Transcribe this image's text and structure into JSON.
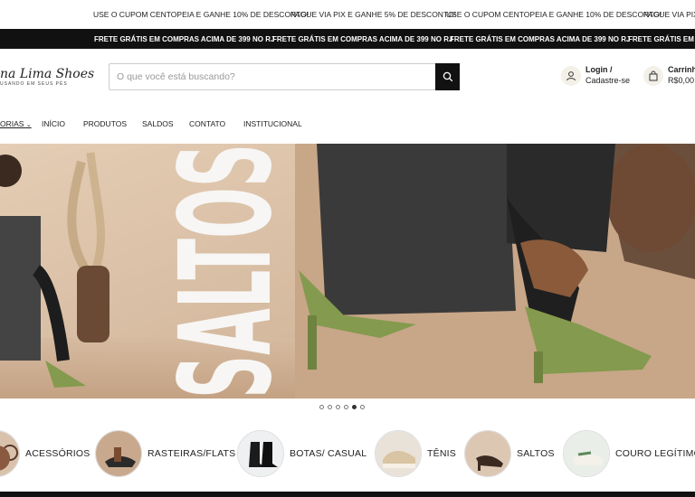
{
  "ticker_top": {
    "messages": [
      "USE O CUPOM CENTOPEIA E GANHE 10% DE DESCONTO!",
      "PAGUE VIA PIX E GANHE 5% DE DESCONTO!",
      "USE O CUPOM CENTOPEIA E GANHE 10% DE DESCONTO!",
      "PAGUE VIA PIX E"
    ]
  },
  "ticker_bottom": {
    "messages": [
      "FRETE GRÁTIS EM COMPRAS ACIMA DE 399 NO RJ",
      "FRETE GRÁTIS EM COMPRAS ACIMA DE 399 NO RJ",
      "FRETE GRÁTIS EM COMPRAS ACIMA DE 399 NO RJ",
      "FRETE GRÁTIS EM C"
    ]
  },
  "header": {
    "logo_text": "na Lima Shoes",
    "logo_tagline": "USANDO EM SEUS PÉS",
    "search_placeholder": "O que você está buscando?",
    "account_line1": "Login /",
    "account_line2": "Cadastre-se",
    "cart_line1": "Carrinho",
    "cart_line2": "R$0,00"
  },
  "nav": {
    "items": [
      "ORIAS",
      "INÍCIO",
      "PRODUTOS",
      "SALDOS",
      "CONTATO",
      "INSTITUCIONAL"
    ]
  },
  "banner": {
    "headline": "SALTOS",
    "slides_total": 6,
    "active_slide": 5
  },
  "categories": [
    {
      "label": "ACESSÓRIOS",
      "icon": "glasses-icon"
    },
    {
      "label": "RASTEIRAS/FLATS",
      "icon": "flat-shoe-icon"
    },
    {
      "label": "BOTAS/ CASUAL",
      "icon": "boot-icon"
    },
    {
      "label": "TÊNIS",
      "icon": "sneaker-icon"
    },
    {
      "label": "SALTOS",
      "icon": "heel-icon"
    },
    {
      "label": "COURO LEGÍTIMO",
      "icon": "leather-shoe-icon"
    }
  ],
  "colors": {
    "brand_dark": "#111111",
    "accent_green": "#7d9a4a",
    "banner_bg": "#d8c0a8"
  }
}
